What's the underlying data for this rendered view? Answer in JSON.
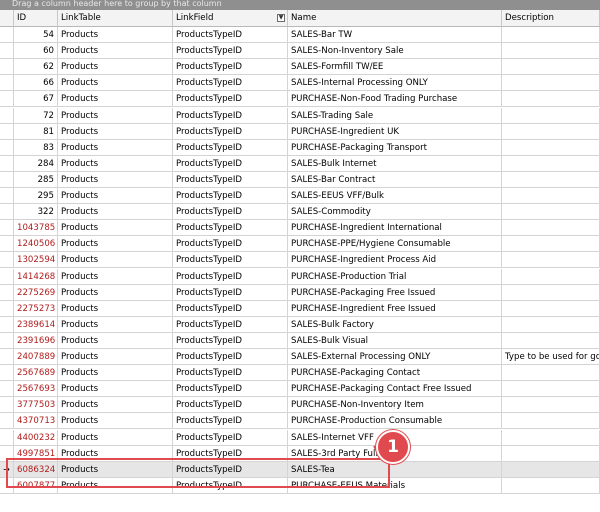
{
  "group_panel": {
    "hint": "Drag a column header here to group by that column"
  },
  "columns": {
    "id": "ID",
    "link_table": "LinkTable",
    "link_field": "LinkField",
    "name": "Name",
    "description": "Description"
  },
  "filter_icon_name": "filter-icon",
  "rows": [
    {
      "id": "54",
      "link_table": "Products",
      "link_field": "ProductsTypeID",
      "name": "SALES-Bar TW",
      "description": ""
    },
    {
      "id": "60",
      "link_table": "Products",
      "link_field": "ProductsTypeID",
      "name": "SALES-Non-Inventory Sale",
      "description": ""
    },
    {
      "id": "62",
      "link_table": "Products",
      "link_field": "ProductsTypeID",
      "name": "SALES-Formfill TW/EE",
      "description": ""
    },
    {
      "id": "66",
      "link_table": "Products",
      "link_field": "ProductsTypeID",
      "name": "SALES-Internal Processing ONLY",
      "description": ""
    },
    {
      "id": "67",
      "link_table": "Products",
      "link_field": "ProductsTypeID",
      "name": "PURCHASE-Non-Food Trading Purchase",
      "description": ""
    },
    {
      "id": "72",
      "link_table": "Products",
      "link_field": "ProductsTypeID",
      "name": "SALES-Trading Sale",
      "description": ""
    },
    {
      "id": "81",
      "link_table": "Products",
      "link_field": "ProductsTypeID",
      "name": "PURCHASE-Ingredient UK",
      "description": ""
    },
    {
      "id": "83",
      "link_table": "Products",
      "link_field": "ProductsTypeID",
      "name": "PURCHASE-Packaging Transport",
      "description": ""
    },
    {
      "id": "284",
      "link_table": "Products",
      "link_field": "ProductsTypeID",
      "name": "SALES-Bulk Internet",
      "description": ""
    },
    {
      "id": "285",
      "link_table": "Products",
      "link_field": "ProductsTypeID",
      "name": "SALES-Bar Contract",
      "description": ""
    },
    {
      "id": "295",
      "link_table": "Products",
      "link_field": "ProductsTypeID",
      "name": "SALES-EEUS VFF/Bulk",
      "description": ""
    },
    {
      "id": "322",
      "link_table": "Products",
      "link_field": "ProductsTypeID",
      "name": "SALES-Commodity",
      "description": ""
    },
    {
      "id": "1043785",
      "link_table": "Products",
      "link_field": "ProductsTypeID",
      "name": "PURCHASE-Ingredient International",
      "description": ""
    },
    {
      "id": "1240506",
      "link_table": "Products",
      "link_field": "ProductsTypeID",
      "name": "PURCHASE-PPE/Hygiene Consumable",
      "description": ""
    },
    {
      "id": "1302594",
      "link_table": "Products",
      "link_field": "ProductsTypeID",
      "name": "PURCHASE-Ingredient Process Aid",
      "description": ""
    },
    {
      "id": "1414268",
      "link_table": "Products",
      "link_field": "ProductsTypeID",
      "name": "PURCHASE-Production Trial",
      "description": ""
    },
    {
      "id": "2275269",
      "link_table": "Products",
      "link_field": "ProductsTypeID",
      "name": "PURCHASE-Packaging Free Issued",
      "description": ""
    },
    {
      "id": "2275273",
      "link_table": "Products",
      "link_field": "ProductsTypeID",
      "name": "PURCHASE-Ingredient Free Issued",
      "description": ""
    },
    {
      "id": "2389614",
      "link_table": "Products",
      "link_field": "ProductsTypeID",
      "name": "SALES-Bulk Factory",
      "description": ""
    },
    {
      "id": "2391696",
      "link_table": "Products",
      "link_field": "ProductsTypeID",
      "name": "SALES-Bulk Visual",
      "description": ""
    },
    {
      "id": "2407889",
      "link_table": "Products",
      "link_field": "ProductsTypeID",
      "name": "SALES-External Processing ONLY",
      "description": "Type to be used for goo"
    },
    {
      "id": "2567689",
      "link_table": "Products",
      "link_field": "ProductsTypeID",
      "name": "PURCHASE-Packaging Contact",
      "description": ""
    },
    {
      "id": "2567693",
      "link_table": "Products",
      "link_field": "ProductsTypeID",
      "name": "PURCHASE-Packaging Contact Free Issued",
      "description": ""
    },
    {
      "id": "3777503",
      "link_table": "Products",
      "link_field": "ProductsTypeID",
      "name": "PURCHASE-Non-Inventory Item",
      "description": ""
    },
    {
      "id": "4370713",
      "link_table": "Products",
      "link_field": "ProductsTypeID",
      "name": "PURCHASE-Production Consumable",
      "description": ""
    },
    {
      "id": "4400232",
      "link_table": "Products",
      "link_field": "ProductsTypeID",
      "name": "SALES-Internet VFF",
      "description": ""
    },
    {
      "id": "4997851",
      "link_table": "Products",
      "link_field": "ProductsTypeID",
      "name": "SALES-3rd Party Fulfil",
      "description": ""
    },
    {
      "id": "6086324",
      "link_table": "Products",
      "link_field": "ProductsTypeID",
      "name": "SALES-Tea",
      "description": "",
      "selected": true
    },
    {
      "id": "6007877",
      "link_table": "Products",
      "link_field": "ProductsTypeID",
      "name": "PURCHASE-EEUS Materials",
      "description": ""
    }
  ],
  "row_indicator_glyph": "→",
  "callout": {
    "number": "1",
    "color": "#e0494d"
  }
}
